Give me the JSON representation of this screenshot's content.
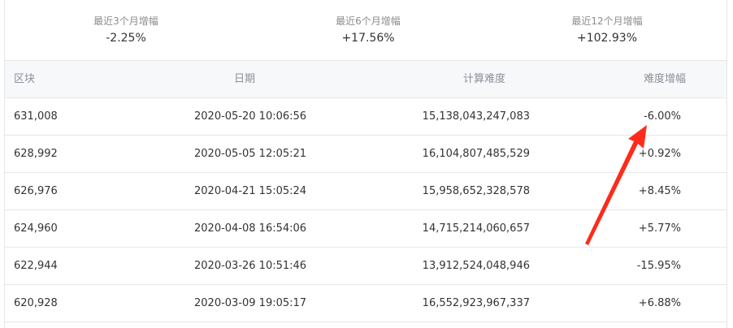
{
  "stats": [
    {
      "label": "最近3个月增幅",
      "value": "-2.25%"
    },
    {
      "label": "最近6个月增幅",
      "value": "+17.56%"
    },
    {
      "label": "最近12个月增幅",
      "value": "+102.93%"
    }
  ],
  "table": {
    "headers": [
      "区块",
      "日期",
      "计算难度",
      "难度增幅"
    ],
    "rows": [
      {
        "block": "631,008",
        "date": "2020-05-20 10:06:56",
        "difficulty": "15,138,043,247,083",
        "change": "-6.00%"
      },
      {
        "block": "628,992",
        "date": "2020-05-05 12:05:21",
        "difficulty": "16,104,807,485,529",
        "change": "+0.92%"
      },
      {
        "block": "626,976",
        "date": "2020-04-21 15:05:24",
        "difficulty": "15,958,652,328,578",
        "change": "+8.45%"
      },
      {
        "block": "624,960",
        "date": "2020-04-08 16:54:06",
        "difficulty": "14,715,214,060,657",
        "change": "+5.77%"
      },
      {
        "block": "622,944",
        "date": "2020-03-26 10:51:46",
        "difficulty": "13,912,524,048,946",
        "change": "-15.95%"
      },
      {
        "block": "620,928",
        "date": "2020-03-09 19:05:17",
        "difficulty": "16,552,923,967,337",
        "change": "+6.88%"
      }
    ]
  },
  "annotation": {
    "color": "#ff2a1a"
  }
}
